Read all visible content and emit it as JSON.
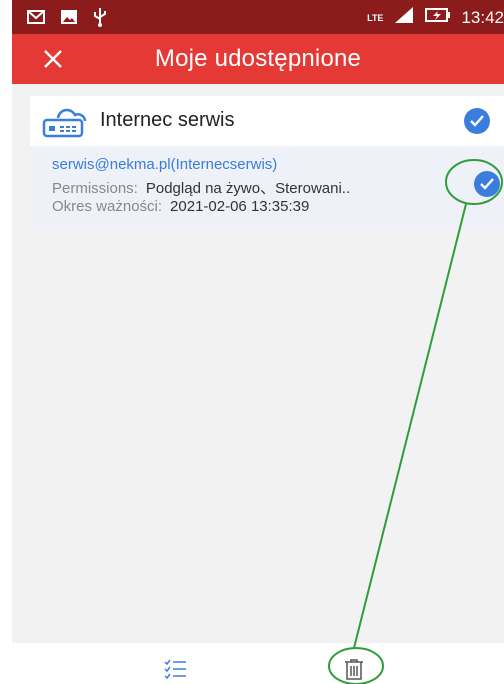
{
  "status_bar": {
    "time": "13:42",
    "network": "LTE",
    "icons": [
      "gmail-icon",
      "gallery-icon",
      "usb-icon",
      "signal-icon",
      "battery-charging-icon"
    ]
  },
  "header": {
    "title": "Moje udostępnione",
    "close_icon": "close-icon",
    "background": "#e53935"
  },
  "device": {
    "name": "Internec serwis",
    "icon": "cloud-recorder-icon",
    "checked": true
  },
  "share": {
    "email": "serwis@nekma.pl(Internecserwis)",
    "permissions_label": "Permissions:",
    "permissions_value": "Podgląd na żywo、Sterowani..",
    "validity_label": "Okres ważności:",
    "validity_value": "2021-02-06 13:35:39",
    "checked": true
  },
  "bottom_bar": {
    "select_all_icon": "checklist-icon",
    "delete_icon": "trash-icon"
  },
  "colors": {
    "status_bar": "#8c1c1c",
    "accent_blue": "#3b7ddd",
    "annotation": "#2e9e3a"
  }
}
